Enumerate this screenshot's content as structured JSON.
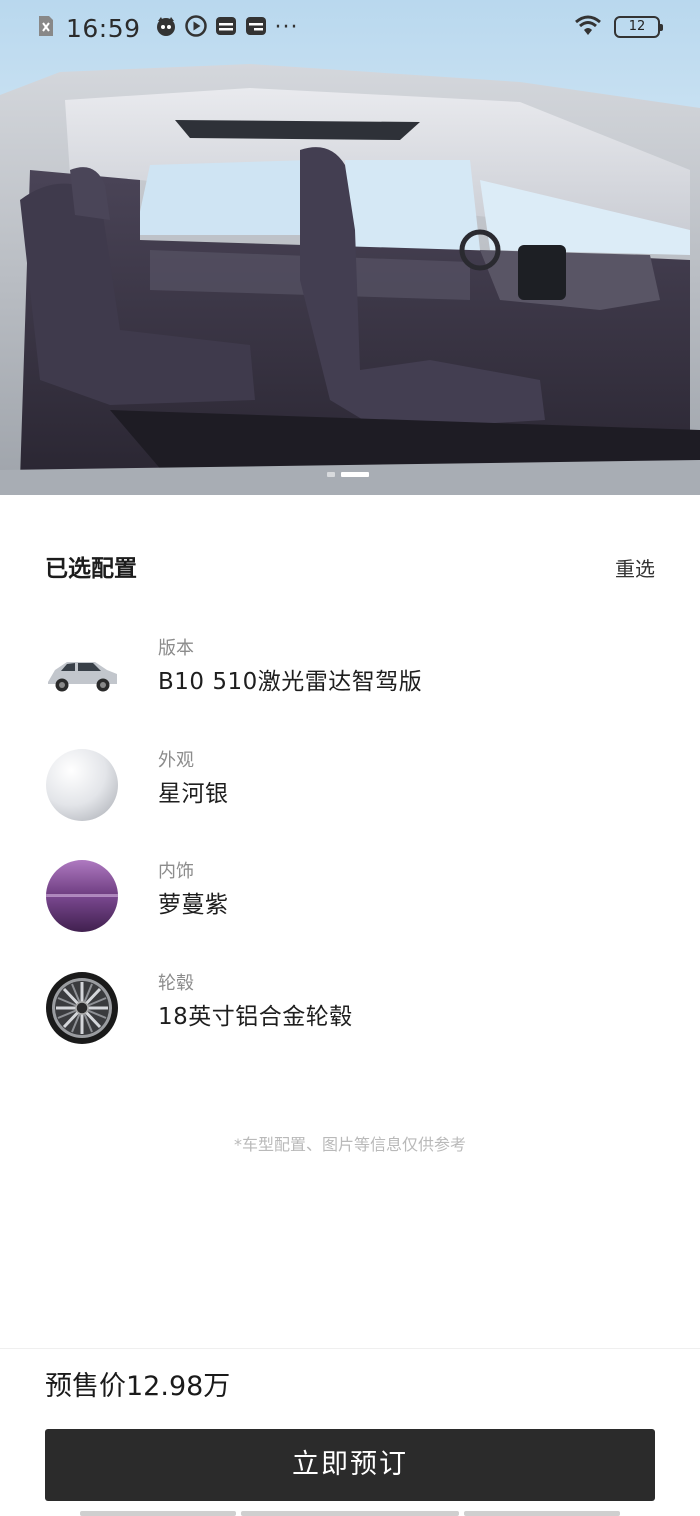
{
  "status_bar": {
    "time": "16:59",
    "more": "···",
    "battery": "12",
    "left_icons": [
      "sim-off-icon",
      "cat-app-icon",
      "video-play-icon",
      "wallet-card-icon",
      "card-icon"
    ],
    "right_icons": [
      "wifi-icon",
      "battery-icon"
    ]
  },
  "hero": {
    "alt": "车辆内饰",
    "page_count": 2,
    "active_page": 2
  },
  "config": {
    "title": "已选配置",
    "reselect_label": "重选",
    "items": [
      {
        "label": "版本",
        "value": "B10 510激光雷达智驾版",
        "thumb": "car-thumbnail"
      },
      {
        "label": "外观",
        "value": "星河银",
        "thumb": "silver-swatch",
        "color": "#d9dadd"
      },
      {
        "label": "内饰",
        "value": "萝蔓紫",
        "thumb": "purple-swatch",
        "color": "#6b3a7c"
      },
      {
        "label": "轮毂",
        "value": "18英寸铝合金轮毂",
        "thumb": "wheel-icon"
      }
    ]
  },
  "disclaimer": "*车型配置、图片等信息仅供参考",
  "footer": {
    "price": "预售价12.98万",
    "order_button": "立即预订"
  },
  "colors": {
    "button_bg": "#2b2b2b",
    "sky": "#b9d8ee",
    "seat": "#3f3a4c",
    "car_silver": "#b8bcc3"
  }
}
